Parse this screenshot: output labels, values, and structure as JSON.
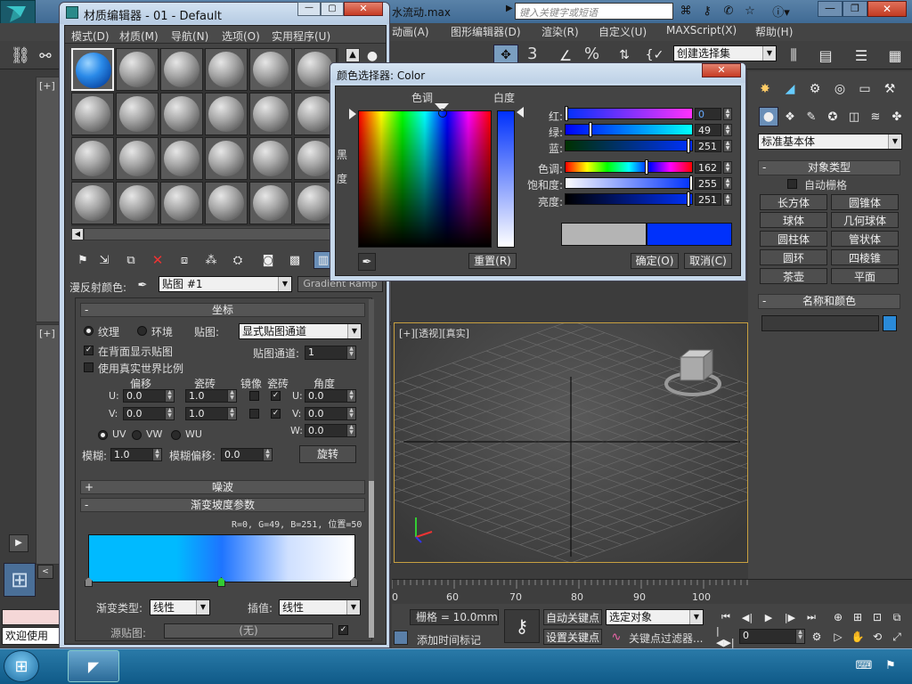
{
  "app": {
    "file_title": "水流动.max",
    "search_placeholder": "键入关键字或短语",
    "menu": [
      "动画(A)",
      "图形编辑器(D)",
      "渲染(R)",
      "自定义(U)",
      "MAXScript(X)",
      "帮助(H)"
    ],
    "toolbar_3": "3",
    "toolbar_pct": "%",
    "selection_set": "创建选择集",
    "viewport_tl_label": "[+]",
    "viewport_ml_label": "[+]",
    "viewport_label": "[+][透视][真实]",
    "timeline_ticks": [
      "0",
      "60",
      "70",
      "80",
      "90",
      "100"
    ],
    "status": {
      "welcome": "欢迎使用",
      "grid": "栅格 = 10.0mm",
      "add_time_tag": "添加时间标记",
      "auto_key": "自动关键点",
      "set_key": "设置关键点",
      "selected_object": "选定对象",
      "key_filter": "关键点过滤器...",
      "frame": "0"
    }
  },
  "command_panel": {
    "category": "标准基本体",
    "object_type_title": "对象类型",
    "auto_grid": "自动栅格",
    "buttons": [
      "长方体",
      "圆锥体",
      "球体",
      "几何球体",
      "圆柱体",
      "管状体",
      "圆环",
      "四棱锥",
      "茶壶",
      "平面"
    ],
    "name_color_title": "名称和颜色"
  },
  "material_editor": {
    "title": "材质编辑器 - 01 - Default",
    "menu": [
      "模式(D)",
      "材质(M)",
      "导航(N)",
      "选项(O)",
      "实用程序(U)"
    ],
    "diffuse_label": "漫反射颜色:",
    "map_name": "贴图 #1",
    "map_type": "Gradient Ramp",
    "coords_title": "坐标",
    "texture": "纹理",
    "environ": "环境",
    "mapping_label": "贴图:",
    "mapping_value": "显式贴图通道",
    "show_back": "在背面显示贴图",
    "map_channel_label": "贴图通道:",
    "map_channel": "1",
    "real_world": "使用真实世界比例",
    "offset": "偏移",
    "tiling": "瓷砖",
    "mirror": "镜像",
    "tile": "瓷砖",
    "angle": "角度",
    "u": "U:",
    "v": "V:",
    "w": "W:",
    "u_offset": "0.0",
    "v_offset": "0.0",
    "u_tiling": "1.0",
    "v_tiling": "1.0",
    "u_angle": "0.0",
    "v_angle": "0.0",
    "w_angle": "0.0",
    "uv": "UV",
    "vw": "VW",
    "wu": "WU",
    "blur_label": "模糊:",
    "blur": "1.0",
    "blur_offset_label": "模糊偏移:",
    "blur_offset": "0.0",
    "rotate": "旋转",
    "noise_title": "噪波",
    "ramp_title": "渐变坡度参数",
    "ramp_info": "R=0, G=49, B=251, 位置=50",
    "ramp_type_label": "渐变类型:",
    "ramp_type": "线性",
    "interp_label": "插值:",
    "interp": "线性",
    "source_map_label": "源贴图:",
    "source_map": "(无)"
  },
  "color_picker": {
    "title": "颜色选择器: Color",
    "hue_label": "色调",
    "white_label": "白度",
    "black_label": "黑",
    "degree_label": "度",
    "reset": "重置(R)",
    "ok": "确定(O)",
    "cancel": "取消(C)",
    "red_label": "红:",
    "green_label": "绿:",
    "blue_label": "蓝:",
    "hue2_label": "色调:",
    "sat_label": "饱和度:",
    "val_label": "亮度:",
    "red": "0",
    "green": "49",
    "blue": "251",
    "hue": "162",
    "sat": "255",
    "val": "251",
    "red_level": 0,
    "green_level": 0.19,
    "blue_level": 0.98,
    "hue_level": 0.64,
    "sat_level": 1.0,
    "val_level": 0.98,
    "old_color": "#b4b4b4",
    "new_color": "#0031fb"
  },
  "colors": {
    "accent": "#0b6fe8",
    "ramp_left": "#00baff",
    "ramp_mid": "#1e74ff"
  }
}
